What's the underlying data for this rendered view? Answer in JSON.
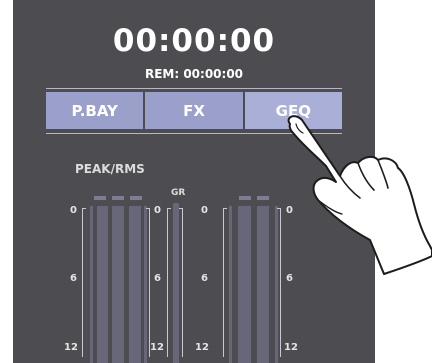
{
  "recorder": {
    "time_counter": "00:00:00",
    "remaining": "REM: 00:00:00"
  },
  "tabs": [
    {
      "label": "P.BAY",
      "active": false
    },
    {
      "label": "FX",
      "active": false
    },
    {
      "label": "GEQ",
      "active": true
    }
  ],
  "meter_section": {
    "title": "PEAK/RMS",
    "gain_reduction_label": "GR",
    "scale_ticks": [
      "0",
      "6",
      "12"
    ]
  },
  "colors": {
    "panel_background": "#4d4c50",
    "tab_background": "#9aa0c9",
    "meter_bar": "#68677a"
  },
  "icons": {
    "hand": "pointing-hand-icon"
  }
}
